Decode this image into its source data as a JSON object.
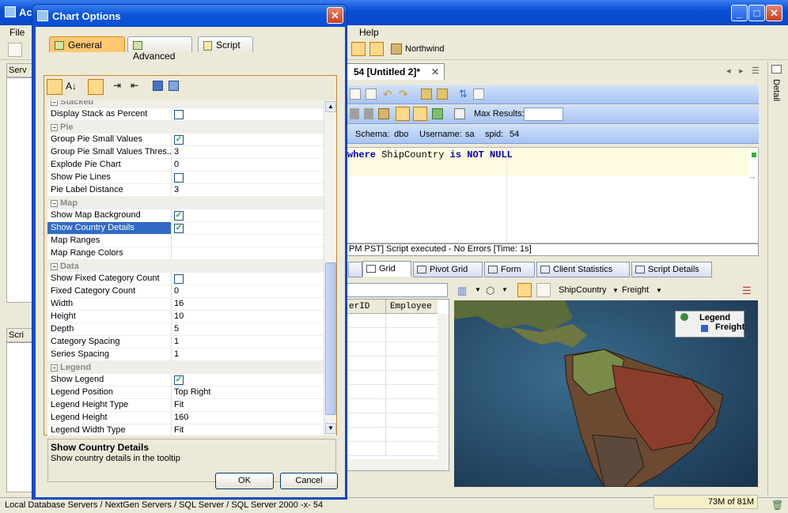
{
  "app": {
    "title": "Ac",
    "menu": [
      "File",
      "Help"
    ],
    "database": "Northwind",
    "doc_tab": "54 [Untitled 2]*",
    "side_label_right": "Detail",
    "side_label_left_top": "Serv",
    "side_label_left_bottom": "Scri"
  },
  "query_toolbar": {
    "max_results_label": "Max Results:",
    "schema_label": "Schema:",
    "schema_value": "dbo",
    "username_label": "Username:",
    "username_value": "sa",
    "spid_label": "spid:",
    "spid_value": "54"
  },
  "editor": {
    "kw_where": "where",
    "col": "ShipCountry",
    "kw_is_not_null": "is NOT NULL"
  },
  "exec_status": "PM PST] Script executed - No Errors [Time: 1s]",
  "result_tabs": [
    "Grid",
    "Pivot Grid",
    "Form",
    "Client Statistics",
    "Script Details"
  ],
  "grid_headers": [
    "erID",
    "Employee"
  ],
  "map_toolbar": {
    "dim": "ShipCountry",
    "measure": "Freight"
  },
  "map_legend": {
    "title": "Legend",
    "series": "Freight"
  },
  "statusbar": {
    "path": "Local Database Servers / NextGen Servers / SQL Server / SQL Server 2000 -x- 54",
    "memory": "73M of 81M"
  },
  "dialog": {
    "title": "Chart Options",
    "tabs": [
      "General",
      "Advanced",
      "Script"
    ],
    "sections": [
      {
        "name": "Stacked",
        "rows": [
          {
            "label": "Display Stack as Percent",
            "checkbox": true,
            "checked": false
          }
        ]
      },
      {
        "name": "Pie",
        "rows": [
          {
            "label": "Group Pie Small Values",
            "checkbox": true,
            "checked": true
          },
          {
            "label": "Group Pie Small Values Thres...",
            "value": "3"
          },
          {
            "label": "Explode Pie Chart",
            "value": "0"
          },
          {
            "label": "Show Pie Lines",
            "checkbox": true,
            "checked": false
          },
          {
            "label": "Pie Label Distance",
            "value": "3"
          }
        ]
      },
      {
        "name": "Map",
        "rows": [
          {
            "label": "Show Map Background",
            "checkbox": true,
            "checked": true
          },
          {
            "label": "Show Country Details",
            "checkbox": true,
            "checked": true,
            "selected": true
          },
          {
            "label": "Map Ranges",
            "value": ""
          },
          {
            "label": "Map Range Colors",
            "value": ""
          }
        ]
      },
      {
        "name": "Data",
        "rows": [
          {
            "label": "Show Fixed Category Count",
            "checkbox": true,
            "checked": false
          },
          {
            "label": "Fixed Category Count",
            "value": "0"
          },
          {
            "label": "Width",
            "value": "16"
          },
          {
            "label": "Height",
            "value": "10"
          },
          {
            "label": "Depth",
            "value": "5"
          },
          {
            "label": "Category Spacing",
            "value": "1"
          },
          {
            "label": "Series Spacing",
            "value": "1"
          }
        ]
      },
      {
        "name": "Legend",
        "rows": [
          {
            "label": "Show Legend",
            "checkbox": true,
            "checked": true
          },
          {
            "label": "Legend Position",
            "value": "Top Right"
          },
          {
            "label": "Legend Height Type",
            "value": "Fit"
          },
          {
            "label": "Legend Height",
            "value": "160"
          },
          {
            "label": "Legend Width Type",
            "value": "Fit"
          }
        ]
      }
    ],
    "description_title": "Show Country Details",
    "description_text": "Show country details in the tooltip",
    "ok_label": "OK",
    "cancel_label": "Cancel"
  }
}
